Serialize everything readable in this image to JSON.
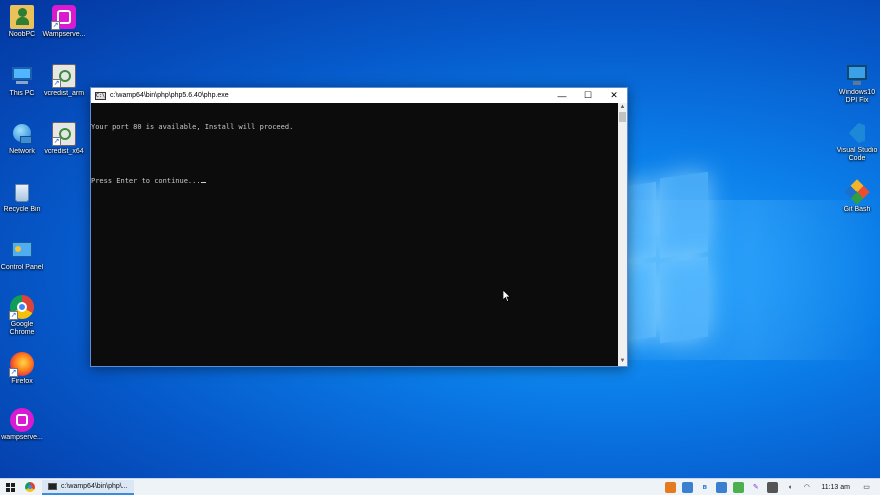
{
  "desktop": {
    "left_icons": [
      {
        "label": "NoobPC",
        "icon": "user-folder-icon"
      },
      {
        "label": "Wampserve...",
        "icon": "wampserver-installer-icon"
      },
      {
        "label": "This PC",
        "icon": "computer-icon"
      },
      {
        "label": "vcredist_arm",
        "icon": "installer-icon"
      },
      {
        "label": "Network",
        "icon": "network-icon"
      },
      {
        "label": "vcredist_x64",
        "icon": "installer-icon"
      },
      {
        "label": "Recycle Bin",
        "icon": "recycle-bin-icon"
      },
      {
        "label": "Control Panel",
        "icon": "control-panel-icon"
      },
      {
        "label": "Google Chrome",
        "icon": "chrome-icon"
      },
      {
        "label": "Firefox",
        "icon": "firefox-icon"
      },
      {
        "label": "wampserve...",
        "icon": "wampserver-icon"
      }
    ],
    "right_icons": [
      {
        "label": "Windows10 DPI Fix",
        "icon": "monitor-icon"
      },
      {
        "label": "Visual Studio Code",
        "icon": "vscode-icon"
      },
      {
        "label": "Git Bash",
        "icon": "git-bash-icon"
      }
    ]
  },
  "console": {
    "title": "c:\\wamp64\\bin\\php\\php5.6.40\\php.exe",
    "lines": [
      "Your port 80 is available, Install will proceed.",
      "",
      "Press Enter to continue..."
    ],
    "minimize": "—",
    "maximize": "☐",
    "close": "✕"
  },
  "taskbar": {
    "task_label": "c:\\wamp64\\bin\\php\\...",
    "clock": "11:13 am",
    "colors": {
      "accent": "#3a8dde"
    }
  }
}
